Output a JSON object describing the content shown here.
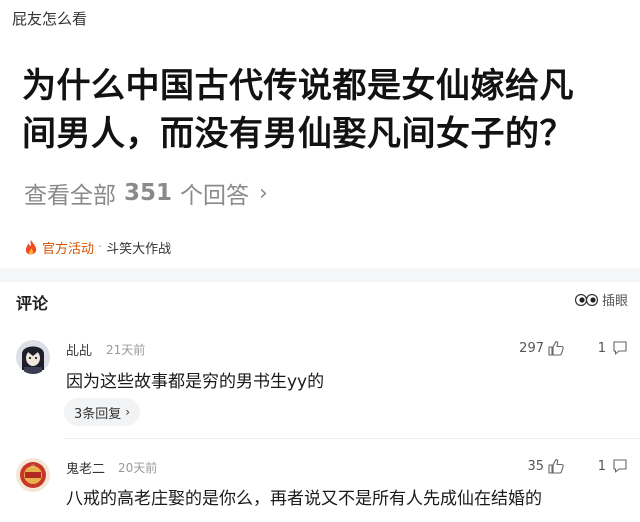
{
  "header": {
    "label": "屁友怎么看"
  },
  "question": {
    "line1": "为什么中国古代传说都是女仙嫁给凡",
    "line2": "间男人，而没有男仙娶凡间女子的？"
  },
  "answers": {
    "prefix": "查看全部",
    "count": "351",
    "suffix": "个回答"
  },
  "activity": {
    "tag": "官方活动",
    "separator": "·",
    "topic": "斗笑大作战",
    "icon": "fire-icon"
  },
  "comments_section": {
    "title": "评论",
    "eyes_label": "插眼",
    "eyes_icon": "eyes-icon"
  },
  "comments": [
    {
      "user": "乩乩",
      "time": "21天前",
      "text": "因为这些故事都是穷的男书生yy的",
      "likes": "297",
      "replies_count": "1",
      "replies_button": "3条回复"
    },
    {
      "user": "鬼老二",
      "time": "20天前",
      "text": "八戒的高老庄娶的是你么，再者说又不是所有人先成仙在结婚的",
      "likes": "35",
      "replies_count": "1"
    }
  ]
}
